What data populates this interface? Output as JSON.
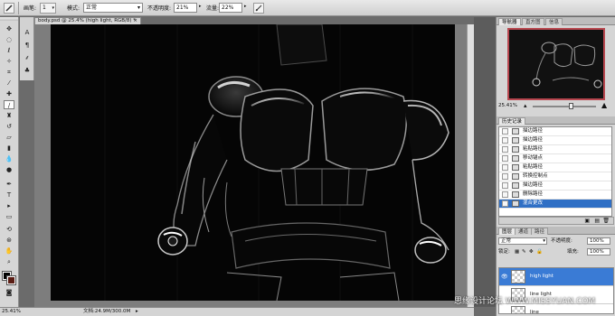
{
  "options_bar": {
    "brush_label": "画笔:",
    "brush_size": "1",
    "mode_label": "模式:",
    "mode_value": "正常",
    "opacity_label": "不透明度:",
    "opacity_value": "21%",
    "flow_label": "流量:",
    "flow_value": "22%"
  },
  "document": {
    "tab_title": "body.psd @ 25.4% (high light, RGB/8) *",
    "zoom": "25.41%",
    "doc_info": "文档:24.9M/300.0M"
  },
  "navigator": {
    "tabs": [
      "导航器",
      "直方图",
      "信息"
    ],
    "zoom": "25.41%"
  },
  "history": {
    "title": "历史记录",
    "items": [
      "描边路径",
      "描边路径",
      "粘贴路径",
      "移动锚点",
      "粘贴路径",
      "转换控制点",
      "描边路径",
      "删除路径",
      "混合更改"
    ]
  },
  "layers": {
    "tabs": [
      "图层",
      "通道",
      "路径"
    ],
    "blend_mode": "正常",
    "opacity_label": "不透明度:",
    "opacity_value": "100%",
    "lock_label": "锁定:",
    "fill_label": "填充:",
    "fill_value": "100%",
    "items": [
      {
        "name": "high light",
        "selected": true,
        "visible": true
      },
      {
        "name": "line light",
        "selected": false,
        "visible": false
      },
      {
        "name": "line",
        "selected": false,
        "visible": false
      }
    ]
  },
  "watermark": "思缘设计论坛 WWW.MISSYUAN.COM",
  "colors": {
    "foreground": "#000000",
    "background": "#5a1d14",
    "selection": "#3a7bd5"
  }
}
